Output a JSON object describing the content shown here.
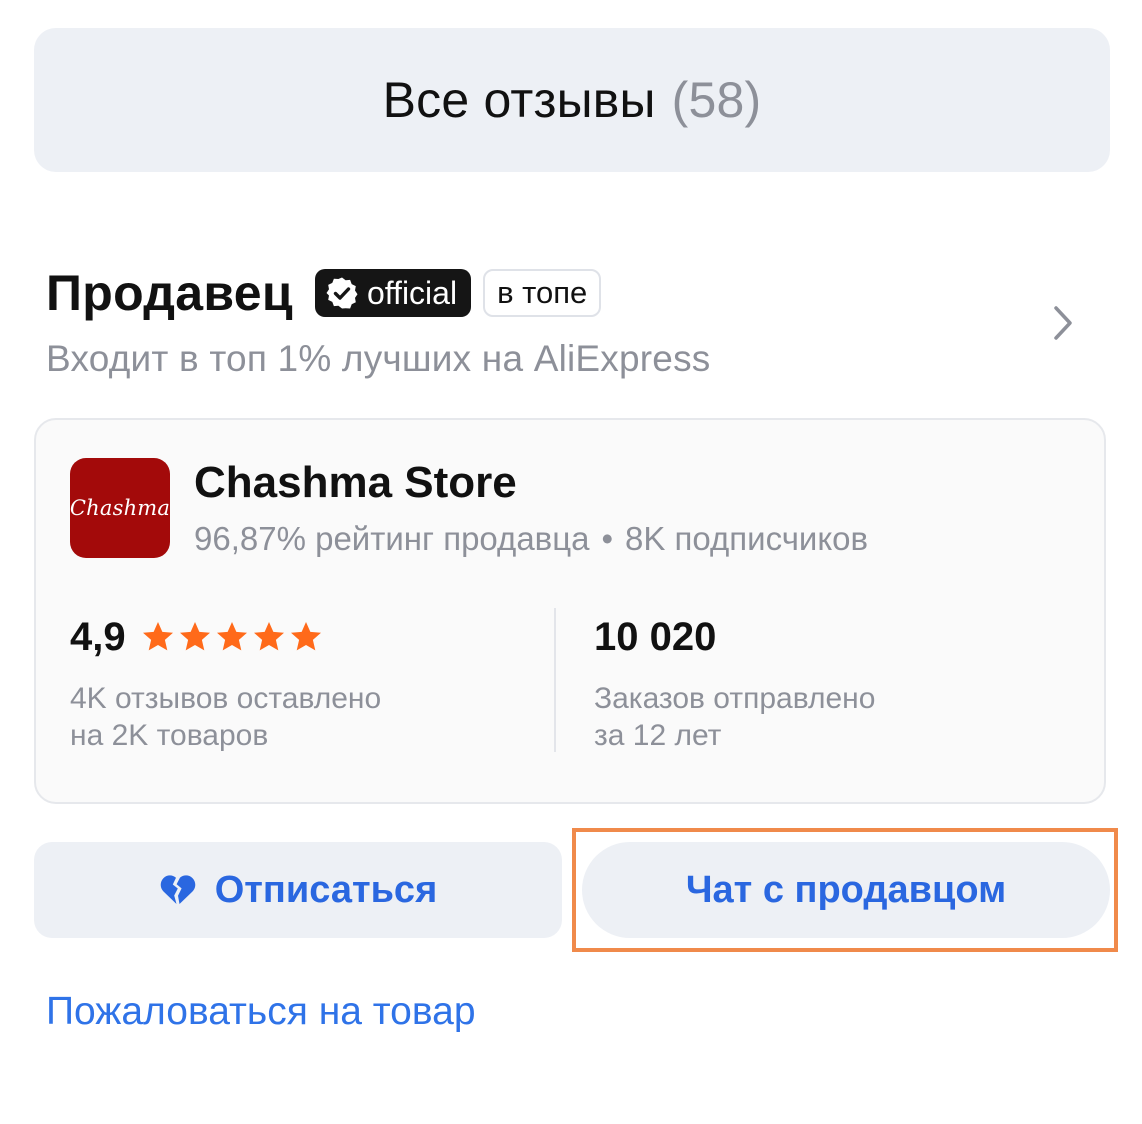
{
  "reviews": {
    "label": "Все отзывы",
    "count": "(58)"
  },
  "seller": {
    "title": "Продавец",
    "badge_official": "official",
    "badge_top": "в топе",
    "subtitle": "Входит в топ 1% лучших на AliExpress"
  },
  "store": {
    "logo_text": "Chashma",
    "name": "Chashma Store",
    "rating_text": "96,87% рейтинг продавца",
    "separator": "•",
    "subscribers": "8K подписчиков"
  },
  "stats": {
    "rating_value": "4,9",
    "stars": 5,
    "reviews_line1": "4K отзывов оставлено",
    "reviews_line2": "на 2K товаров",
    "orders_value": "10 020",
    "orders_line1": "Заказов отправлено",
    "orders_line2": "за 12 лет"
  },
  "actions": {
    "unsubscribe": "Отписаться",
    "chat": "Чат с продавцом",
    "complain": "Пожаловаться на товар"
  },
  "colors": {
    "accent": "#2a67e0",
    "star": "#ff6a1a",
    "highlight": "#f08a4b",
    "logo_bg": "#a30a0a"
  }
}
